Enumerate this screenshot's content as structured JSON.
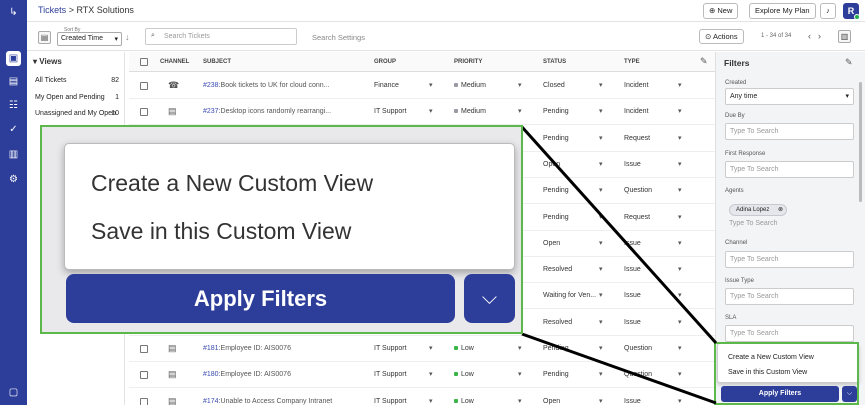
{
  "breadcrumb": {
    "root": "Tickets",
    "separator": ">",
    "current": "RTX Solutions"
  },
  "header": {
    "new_label": "New",
    "explore_label": "Explore My Plan",
    "avatar_initial": "R"
  },
  "toolbar": {
    "sort_by_label": "Sort By",
    "sort_value": "Created Time",
    "search_placeholder": "Search Tickets",
    "search_settings": "Search Settings",
    "actions_label": "Actions",
    "pager": "1 - 34 of 34"
  },
  "views": {
    "title": "Views",
    "items": [
      {
        "label": "All Tickets",
        "count": "82"
      },
      {
        "label": "My Open and Pending",
        "count": "1"
      },
      {
        "label": "Unassigned and My Open",
        "count": "10"
      }
    ]
  },
  "table": {
    "columns": [
      "CHANNEL",
      "SUBJECT",
      "GROUP",
      "PRIORITY",
      "STATUS",
      "TYPE"
    ],
    "rows": [
      {
        "id": "#238:",
        "subject": "Book tickets to UK for cloud conn...",
        "group": "Finance",
        "priority": "Medium",
        "status": "Closed",
        "type": "Incident",
        "channel": "phone"
      },
      {
        "id": "#237:",
        "subject": "Desktop icons randomly rearrangi...",
        "group": "IT Support",
        "priority": "Medium",
        "status": "Pending",
        "type": "Incident",
        "channel": "portal"
      },
      {
        "status": "Pending",
        "type": "Request"
      },
      {
        "status": "Open",
        "type": "Issue"
      },
      {
        "status": "Pending",
        "type": "Question"
      },
      {
        "status": "Pending",
        "type": "Request"
      },
      {
        "status": "Open",
        "type": "Issue"
      },
      {
        "status": "Resolved",
        "type": "Issue"
      },
      {
        "status": "Waiting for Ven...",
        "type": "Issue"
      },
      {
        "status": "Resolved",
        "type": "Issue"
      },
      {
        "id": "#181:",
        "subject": "Employee ID: AIS0076",
        "group": "IT Support",
        "priority": "Low",
        "status": "Pending",
        "type": "Question",
        "channel": "portal"
      },
      {
        "id": "#180:",
        "subject": "Employee ID: AIS0076",
        "group": "IT Support",
        "priority": "Low",
        "status": "Pending",
        "type": "Question",
        "channel": "portal"
      },
      {
        "id": "#174:",
        "subject": "Unable to Access Company Intranet",
        "group": "IT Support",
        "priority": "Low",
        "status": "Open",
        "type": "Issue",
        "channel": "portal"
      }
    ]
  },
  "filters": {
    "title": "Filters",
    "created_label": "Created",
    "created_value": "Any time",
    "due_by_label": "Due By",
    "first_response_label": "First Response",
    "agents_label": "Agents",
    "agent_chip": "Adina Lopez",
    "channel_label": "Channel",
    "issue_type_label": "Issue Type",
    "sla_label": "SLA",
    "placeholder": "Type To Search"
  },
  "dropdown": {
    "create_view": "Create a New Custom View",
    "save_view": "Save in this Custom View",
    "apply_label": "Apply Filters"
  },
  "colors": {
    "brand": "#2d3e9a",
    "highlight": "#5cb84a",
    "medium_priority": "#9a9aa5",
    "low_priority": "#3bb54a"
  }
}
